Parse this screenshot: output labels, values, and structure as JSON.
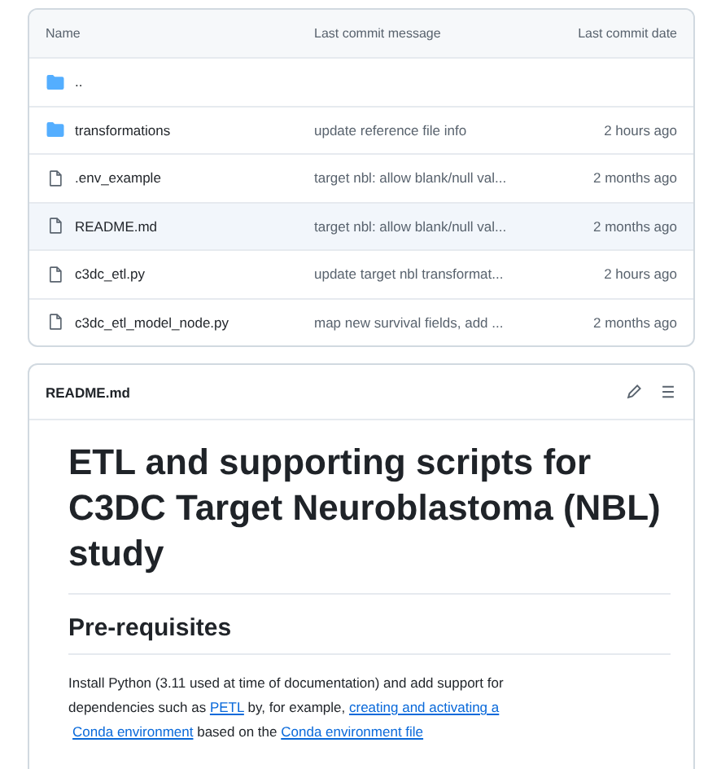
{
  "file_table": {
    "columns": [
      "Name",
      "Last commit message",
      "Last commit date"
    ],
    "rows": [
      {
        "kind": "folder",
        "name": "..",
        "selected": false
      },
      {
        "kind": "folder",
        "name": "transformations",
        "message": "update reference file info",
        "date": "2 hours ago",
        "selected": false
      },
      {
        "kind": "file",
        "name": ".env_example",
        "message": "target nbl: allow blank/null val...",
        "date": "2 months ago",
        "selected": false
      },
      {
        "kind": "file",
        "name": "README.md",
        "message": "target nbl: allow blank/null val...",
        "date": "2 months ago",
        "selected": true
      },
      {
        "kind": "file",
        "name": "c3dc_etl.py",
        "message": "update target nbl transformat...",
        "date": "2 hours ago",
        "selected": false
      },
      {
        "kind": "file",
        "name": "c3dc_etl_model_node.py",
        "message": "map new survival fields, add ...",
        "date": "2 months ago",
        "selected": false
      }
    ]
  },
  "readme": {
    "filename": "README.md",
    "title": "ETL and supporting scripts for C3DC Target Neuroblastoma (NBL) study",
    "section": "Pre-requisites",
    "paragraph": [
      {
        "kind": "text",
        "text": "Install Python (3.11 used at time of documentation) and add support for dependencies such as "
      },
      {
        "kind": "link",
        "text": "PETL"
      },
      {
        "kind": "text",
        "text": " by, for example, "
      },
      {
        "kind": "link",
        "text": "creating and activating a"
      },
      {
        "kind": "link",
        "text": "Conda environment"
      },
      {
        "kind": "text",
        "text": " based on the "
      },
      {
        "kind": "link",
        "text": "Conda environment file"
      }
    ]
  }
}
